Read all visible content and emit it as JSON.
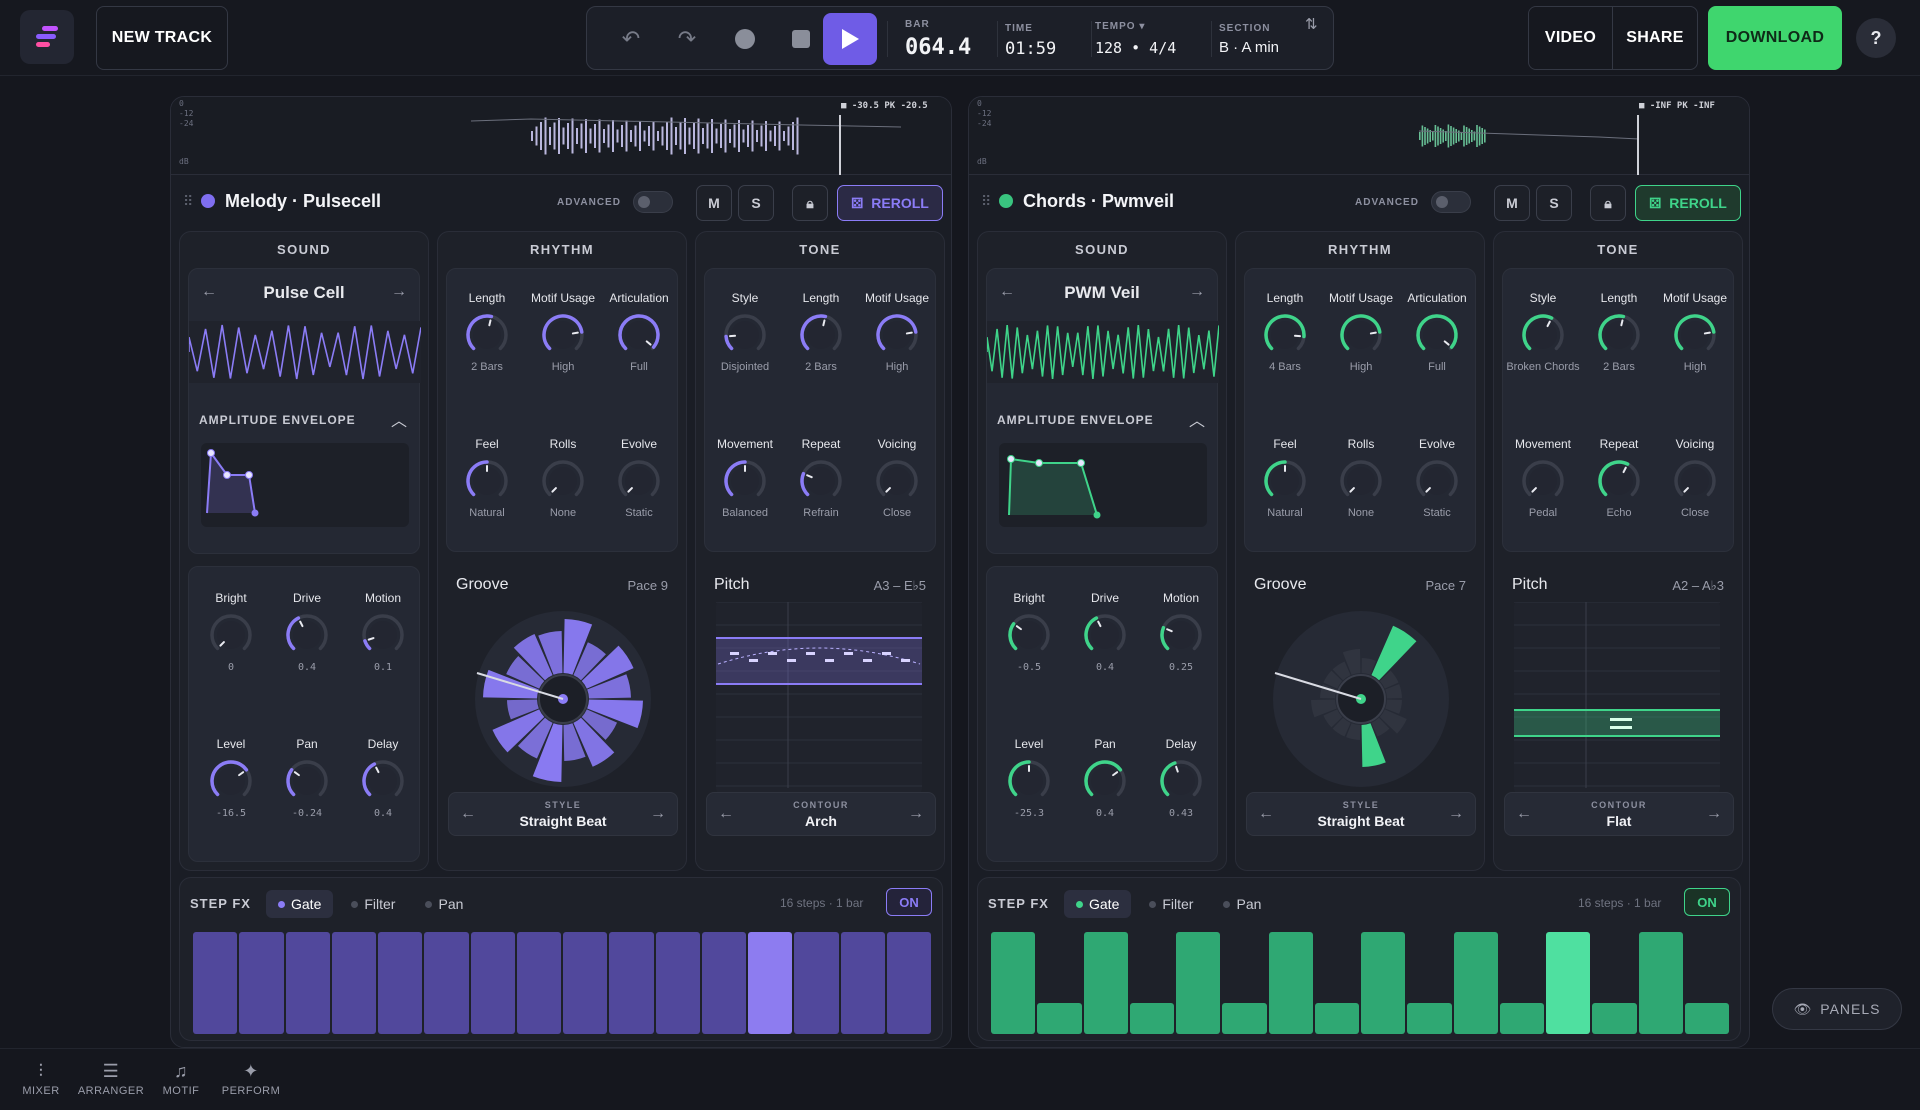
{
  "header": {
    "new_track": "NEW TRACK",
    "video": "VIDEO",
    "share": "SHARE",
    "download": "DOWNLOAD",
    "help": "?"
  },
  "transport": {
    "bar_label": "BAR",
    "bar_value": "064.4",
    "time_label": "TIME",
    "time_value": "01:59",
    "tempo_label": "TEMPO ▾",
    "tempo_value": "128 • 4/4",
    "section_label": "SECTION",
    "section_value": "B · A min"
  },
  "panels_button": "PANELS",
  "bottom": {
    "mixer": "MIXER",
    "arranger": "ARRANGER",
    "motif": "MOTIF",
    "perform": "PERFORM"
  },
  "tracks": [
    {
      "id": "melody",
      "title": "Melody · Pulsecell",
      "accent": "#8b7cf6",
      "dot_color": "#7f6ef0",
      "advanced": "ADVANCED",
      "m": "M",
      "s": "S",
      "reroll": "REROLL",
      "meter": "■ -30.5   PK -20.5",
      "meter_scale": [
        "0",
        "-12",
        "-24",
        "dB"
      ],
      "sound": {
        "header": "SOUND",
        "preset": "Pulse Cell",
        "env_label": "AMPLITUDE ENVELOPE"
      },
      "rhythm": {
        "header": "RHYTHM"
      },
      "tone": {
        "header": "TONE"
      },
      "rhythm_knobs": [
        {
          "label": "Length",
          "value": "2 Bars",
          "level": 0.55
        },
        {
          "label": "Motif Usage",
          "value": "High",
          "level": 0.8
        },
        {
          "label": "Articulation",
          "value": "Full",
          "level": 0.98
        },
        {
          "label": "Feel",
          "value": "Natural",
          "level": 0.5
        },
        {
          "label": "Rolls",
          "value": "None",
          "level": 0.0
        },
        {
          "label": "Evolve",
          "value": "Static",
          "level": 0.0
        }
      ],
      "tone_knobs": [
        {
          "label": "Style",
          "value": "Disjointed",
          "level": 0.15
        },
        {
          "label": "Length",
          "value": "2 Bars",
          "level": 0.55
        },
        {
          "label": "Motif Usage",
          "value": "High",
          "level": 0.8
        },
        {
          "label": "Movement",
          "value": "Balanced",
          "level": 0.5
        },
        {
          "label": "Repeat",
          "value": "Refrain",
          "level": 0.25
        },
        {
          "label": "Voicing",
          "value": "Close",
          "level": 0.0
        }
      ],
      "mix_knobs": [
        {
          "label": "Bright",
          "value": "0",
          "level": 0.0
        },
        {
          "label": "Drive",
          "value": "0.4",
          "level": 0.4
        },
        {
          "label": "Motion",
          "value": "0.1",
          "level": 0.1
        },
        {
          "label": "Level",
          "value": "-16.5",
          "level": 0.7
        },
        {
          "label": "Pan",
          "value": "-0.24",
          "level": 0.3
        },
        {
          "label": "Delay",
          "value": "0.4",
          "level": 0.4
        }
      ],
      "groove": {
        "label": "Groove",
        "pace": "Pace 9",
        "style_label": "STYLE",
        "style": "Straight Beat"
      },
      "pitch": {
        "label": "Pitch",
        "range": "A3 – E♭5",
        "contour_label": "CONTOUR",
        "contour": "Arch"
      },
      "stepfx": {
        "label": "STEP FX",
        "tabs": [
          "Gate",
          "Filter",
          "Pan"
        ],
        "info": "16 steps · 1 bar",
        "on": "ON",
        "steps": [
          1,
          1,
          1,
          1,
          1,
          1,
          1,
          1,
          1,
          1,
          1,
          1,
          1,
          1,
          1,
          1
        ],
        "active_step": 12
      }
    },
    {
      "id": "chords",
      "title": "Chords · Pwmveil",
      "accent": "#3fd48a",
      "dot_color": "#39c47f",
      "advanced": "ADVANCED",
      "m": "M",
      "s": "S",
      "reroll": "REROLL",
      "meter": "■ -INF   PK -INF",
      "meter_scale": [
        "0",
        "-12",
        "-24",
        "dB"
      ],
      "sound": {
        "header": "SOUND",
        "preset": "PWM Veil",
        "env_label": "AMPLITUDE ENVELOPE"
      },
      "rhythm": {
        "header": "RHYTHM"
      },
      "tone": {
        "header": "TONE"
      },
      "rhythm_knobs": [
        {
          "label": "Length",
          "value": "4 Bars",
          "level": 0.85
        },
        {
          "label": "Motif Usage",
          "value": "High",
          "level": 0.8
        },
        {
          "label": "Articulation",
          "value": "Full",
          "level": 0.98
        },
        {
          "label": "Feel",
          "value": "Natural",
          "level": 0.5
        },
        {
          "label": "Rolls",
          "value": "None",
          "level": 0.0
        },
        {
          "label": "Evolve",
          "value": "Static",
          "level": 0.0
        }
      ],
      "tone_knobs": [
        {
          "label": "Style",
          "value": "Broken Chords",
          "level": 0.6
        },
        {
          "label": "Length",
          "value": "2 Bars",
          "level": 0.55
        },
        {
          "label": "Motif Usage",
          "value": "High",
          "level": 0.8
        },
        {
          "label": "Movement",
          "value": "Pedal",
          "level": 0.0
        },
        {
          "label": "Repeat",
          "value": "Echo",
          "level": 0.6
        },
        {
          "label": "Voicing",
          "value": "Close",
          "level": 0.0
        }
      ],
      "mix_knobs": [
        {
          "label": "Bright",
          "value": "-0.5",
          "level": 0.3
        },
        {
          "label": "Drive",
          "value": "0.4",
          "level": 0.4
        },
        {
          "label": "Motion",
          "value": "0.25",
          "level": 0.25
        },
        {
          "label": "Level",
          "value": "-25.3",
          "level": 0.5
        },
        {
          "label": "Pan",
          "value": "0.4",
          "level": 0.7
        },
        {
          "label": "Delay",
          "value": "0.43",
          "level": 0.43
        }
      ],
      "groove": {
        "label": "Groove",
        "pace": "Pace 7",
        "style_label": "STYLE",
        "style": "Straight Beat"
      },
      "pitch": {
        "label": "Pitch",
        "range": "A2 – A♭3",
        "contour_label": "CONTOUR",
        "contour": "Flat"
      },
      "stepfx": {
        "label": "STEP FX",
        "tabs": [
          "Gate",
          "Filter",
          "Pan"
        ],
        "info": "16 steps · 1 bar",
        "on": "ON",
        "steps": [
          1,
          0.3,
          1,
          0.3,
          1,
          0.3,
          1,
          0.3,
          1,
          0.3,
          1,
          0.3,
          1,
          0.3,
          1,
          0.3
        ],
        "active_step": 12
      }
    }
  ]
}
